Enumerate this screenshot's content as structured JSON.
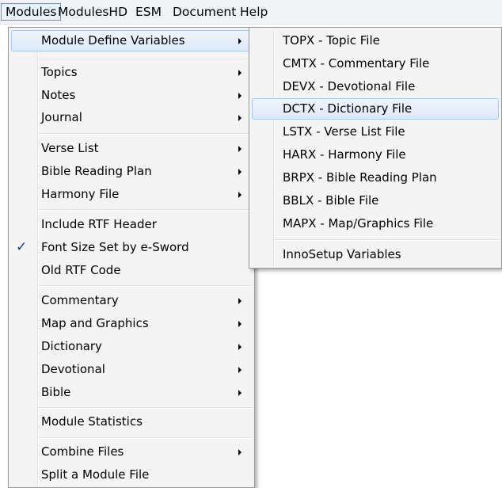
{
  "menubar": {
    "items": [
      "Modules",
      "ModulesHD",
      "ESM",
      "Document",
      "Help"
    ]
  },
  "modules_menu": {
    "items": [
      {
        "label": "Module Define Variables",
        "submenu": true,
        "highlighted": true
      },
      {
        "label": "Topics",
        "submenu": true
      },
      {
        "label": "Notes",
        "submenu": true
      },
      {
        "label": "Journal",
        "submenu": true
      },
      {
        "label": "Verse List",
        "submenu": true
      },
      {
        "label": "Bible Reading Plan",
        "submenu": true
      },
      {
        "label": "Harmony File",
        "submenu": true
      },
      {
        "label": "Include RTF Header",
        "submenu": false
      },
      {
        "label": "Font Size Set by e-Sword",
        "submenu": false,
        "checked": true
      },
      {
        "label": "Old RTF Code",
        "submenu": false
      },
      {
        "label": "Commentary",
        "submenu": true
      },
      {
        "label": "Map and Graphics",
        "submenu": true
      },
      {
        "label": "Dictionary",
        "submenu": true
      },
      {
        "label": "Devotional",
        "submenu": true
      },
      {
        "label": "Bible",
        "submenu": true
      },
      {
        "label": "Module Statistics",
        "submenu": false
      },
      {
        "label": "Combine Files",
        "submenu": true
      },
      {
        "label": "Split a Module File",
        "submenu": false
      }
    ]
  },
  "define_variables_submenu": {
    "items": [
      {
        "label": "TOPX - Topic File"
      },
      {
        "label": "CMTX - Commentary File"
      },
      {
        "label": "DEVX - Devotional File"
      },
      {
        "label": "DCTX - Dictionary File",
        "highlighted": true
      },
      {
        "label": "LSTX - Verse List File"
      },
      {
        "label": "HARX - Harmony File"
      },
      {
        "label": "BRPX - Bible Reading Plan"
      },
      {
        "label": "BBLX - Bible File"
      },
      {
        "label": "MAPX - Map/Graphics File"
      },
      {
        "label": "InnoSetup Variables"
      }
    ]
  },
  "icons": {
    "check": "checkmark-icon",
    "arrow": "submenu-arrow-icon"
  },
  "colors": {
    "highlight_border": "#a8c7ef",
    "highlight_fill": "#dce9f9",
    "menu_bg": "#f4f4f4",
    "check": "#0b3c8c"
  }
}
